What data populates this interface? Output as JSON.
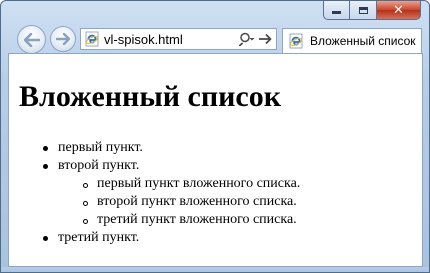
{
  "browser": {
    "address_url": "vl-spisok.html",
    "tab_title": "Вложенный список",
    "icons": {
      "back": "back-arrow-icon",
      "forward": "forward-arrow-icon",
      "page": "ie-page-icon",
      "search": "search-icon",
      "go": "go-arrow-icon",
      "minimize": "minimize-icon",
      "maximize": "maximize-icon",
      "close": "close-icon"
    },
    "colors": {
      "frame": "#b7cde7",
      "close_button": "#c9452a",
      "ie_logo": "#1e6fc9"
    }
  },
  "page": {
    "heading": "Вложенный список",
    "items": [
      {
        "text": "первый пункт."
      },
      {
        "text": "второй пункт.",
        "subitems": [
          {
            "text": "первый пункт вложенного списка."
          },
          {
            "text": "второй пункт вложенного списка."
          },
          {
            "text": "третий пункт вложенного списка."
          }
        ]
      },
      {
        "text": "третий пункт."
      }
    ]
  }
}
